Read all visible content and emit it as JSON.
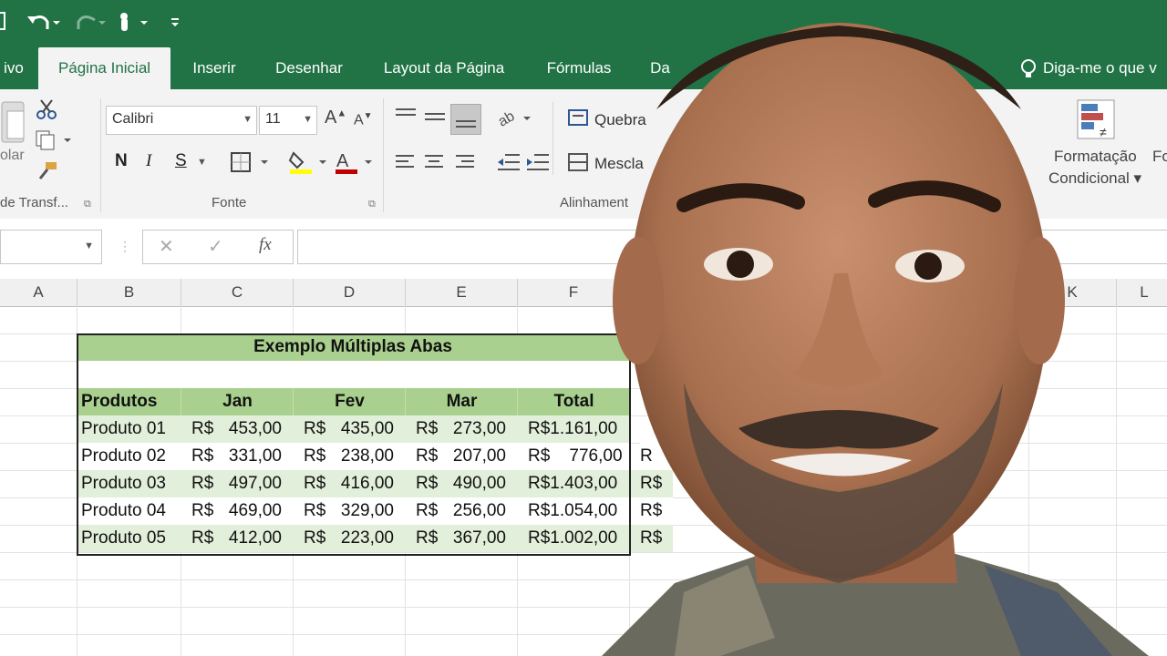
{
  "tabs": [
    {
      "label": "ivo"
    },
    {
      "label": "Página Inicial"
    },
    {
      "label": "Inserir"
    },
    {
      "label": "Desenhar"
    },
    {
      "label": "Layout da Página"
    },
    {
      "label": "Fórmulas"
    },
    {
      "label": "Da"
    }
  ],
  "tell_me": "Diga-me o que v",
  "ribbon": {
    "clipboard": {
      "paste_label": "olar",
      "group_label": "de Transf..."
    },
    "font": {
      "name": "Calibri",
      "size": "11",
      "bold": "N",
      "italic": "I",
      "underline": "S",
      "group_label": "Fonte"
    },
    "alignment": {
      "wrap_label": "Quebra",
      "merge_label": "Mescla",
      "group_label": "Alinhament"
    },
    "styles": {
      "cond_format_line1": "Formatação",
      "cond_format_line2": "Condicional ▾",
      "next_label": "Fo"
    }
  },
  "formula_bar": {
    "fx": "fx"
  },
  "sheet": {
    "columns": [
      "A",
      "B",
      "C",
      "D",
      "E",
      "F",
      "K",
      "L"
    ],
    "table_title": "Exemplo Múltiplas Abas",
    "headers": [
      "Produtos",
      "Jan",
      "Fev",
      "Mar",
      "Total"
    ],
    "rows": [
      {
        "name": "Produto 01",
        "jan": "453,00",
        "fev": "435,00",
        "mar": "273,00",
        "total": "R$1.161,00",
        "extra": ""
      },
      {
        "name": "Produto 02",
        "jan": "331,00",
        "fev": "238,00",
        "mar": "207,00",
        "total": "R$    776,00",
        "extra": "R"
      },
      {
        "name": "Produto 03",
        "jan": "497,00",
        "fev": "416,00",
        "mar": "490,00",
        "total": "R$1.403,00",
        "extra": "R$"
      },
      {
        "name": "Produto 04",
        "jan": "469,00",
        "fev": "329,00",
        "mar": "256,00",
        "total": "R$1.054,00",
        "extra": "R$"
      },
      {
        "name": "Produto 05",
        "jan": "412,00",
        "fev": "223,00",
        "mar": "367,00",
        "total": "R$1.002,00",
        "extra": "R$"
      }
    ],
    "currency": "R$"
  },
  "colors": {
    "excel_green": "#217346",
    "table_dark": "#a9d08e",
    "table_light": "#e2efda"
  }
}
